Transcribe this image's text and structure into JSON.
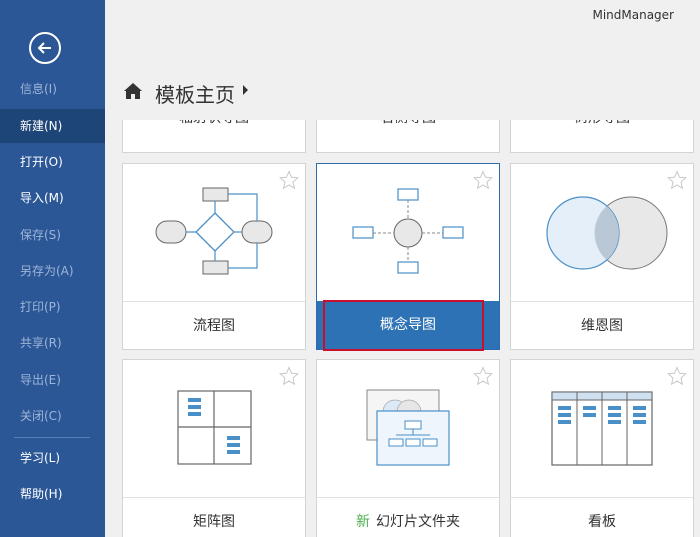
{
  "app": {
    "title": "MindManager"
  },
  "sidebar": {
    "items": [
      {
        "label": "信息(I)",
        "state": "dim"
      },
      {
        "label": "新建(N)",
        "state": "active"
      },
      {
        "label": "打开(O)",
        "state": "normal"
      },
      {
        "label": "导入(M)",
        "state": "normal"
      },
      {
        "label": "保存(S)",
        "state": "dim"
      },
      {
        "label": "另存为(A)",
        "state": "dim"
      },
      {
        "label": "打印(P)",
        "state": "dim"
      },
      {
        "label": "共享(R)",
        "state": "dim"
      },
      {
        "label": "导出(E)",
        "state": "dim"
      },
      {
        "label": "关闭(C)",
        "state": "dim"
      },
      {
        "label": "学习(L)",
        "state": "normal"
      },
      {
        "label": "帮助(H)",
        "state": "normal"
      }
    ]
  },
  "header": {
    "title": "模板主页"
  },
  "templates": {
    "row0": [
      "辐射状导图",
      "右侧导图",
      "树形导图"
    ],
    "row1": [
      "流程图",
      "概念导图",
      "维恩图"
    ],
    "row2": {
      "matrix": "矩阵图",
      "slides_badge": "新",
      "slides": "幻灯片文件夹",
      "kanban": "看板"
    }
  },
  "colors": {
    "sidebar": "#2b5797",
    "selected": "#2d72b4",
    "highlight": "#c8102e"
  }
}
